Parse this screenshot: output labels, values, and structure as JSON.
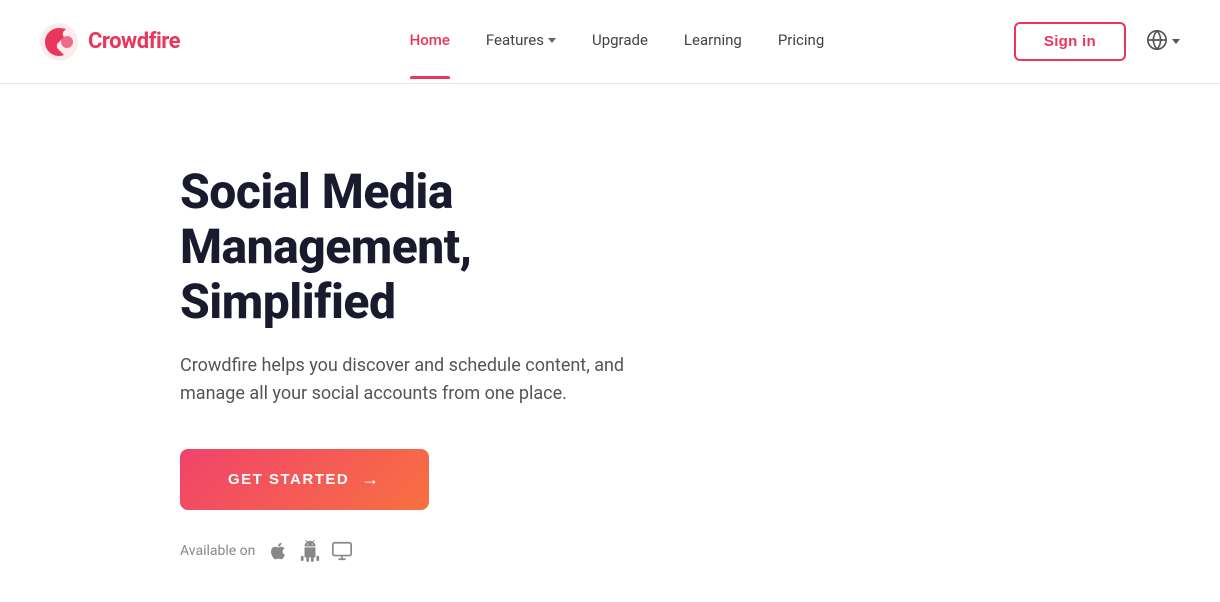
{
  "header": {
    "logo_text": "Crowdfire",
    "nav": {
      "items": [
        {
          "label": "Home",
          "active": true,
          "has_dropdown": false
        },
        {
          "label": "Features",
          "active": false,
          "has_dropdown": true
        },
        {
          "label": "Upgrade",
          "active": false,
          "has_dropdown": false
        },
        {
          "label": "Learning",
          "active": false,
          "has_dropdown": false
        },
        {
          "label": "Pricing",
          "active": false,
          "has_dropdown": false
        }
      ]
    },
    "sign_in_label": "Sign in",
    "globe_label": "Language"
  },
  "hero": {
    "heading": "Social Media Management, Simplified",
    "subtext": "Crowdfire helps you discover and schedule content, and manage all your social accounts from one place.",
    "cta_label": "GET STARTED",
    "cta_arrow": "→",
    "available_on_label": "Available on"
  }
}
